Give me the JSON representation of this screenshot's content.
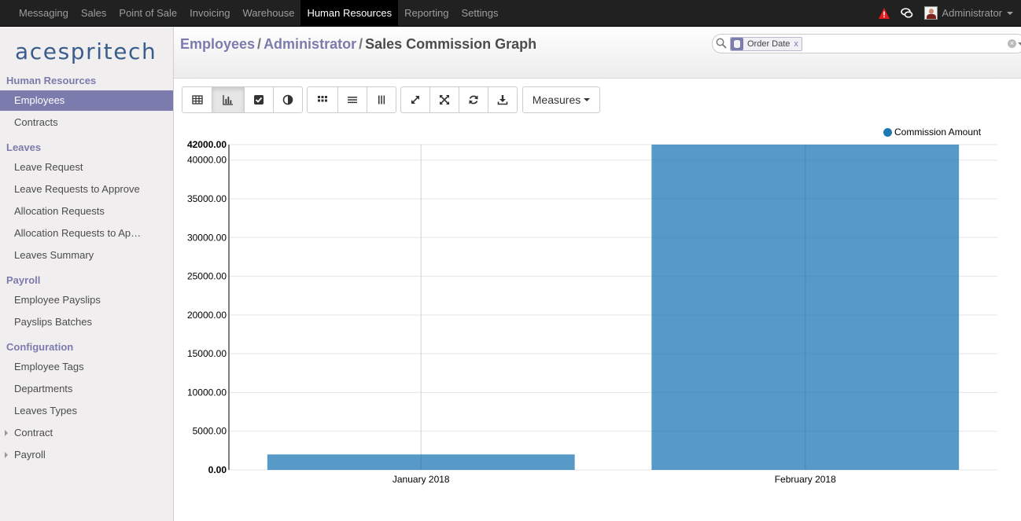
{
  "topbar": {
    "menu": [
      "Messaging",
      "Sales",
      "Point of Sale",
      "Invoicing",
      "Warehouse",
      "Human Resources",
      "Reporting",
      "Settings"
    ],
    "active_index": 5,
    "user_name": "Administrator"
  },
  "sidebar": {
    "logo_text": "acespritech",
    "sections": [
      {
        "title": "Human Resources",
        "items": [
          {
            "label": "Employees",
            "active": true
          },
          {
            "label": "Contracts"
          }
        ]
      },
      {
        "title": "Leaves",
        "items": [
          {
            "label": "Leave Request"
          },
          {
            "label": "Leave Requests to Approve"
          },
          {
            "label": "Allocation Requests"
          },
          {
            "label": "Allocation Requests to Ap…"
          },
          {
            "label": "Leaves Summary"
          }
        ]
      },
      {
        "title": "Payroll",
        "items": [
          {
            "label": "Employee Payslips"
          },
          {
            "label": "Payslips Batches"
          }
        ]
      },
      {
        "title": "Configuration",
        "items": [
          {
            "label": "Employee Tags"
          },
          {
            "label": "Departments"
          },
          {
            "label": "Leaves Types"
          },
          {
            "label": "Contract",
            "expandable": true
          },
          {
            "label": "Payroll",
            "expandable": true
          }
        ]
      }
    ]
  },
  "breadcrumb": {
    "links": [
      "Employees",
      "Administrator"
    ],
    "current": "Sales Commission Graph",
    "separator": "/"
  },
  "search": {
    "facet_label": "Order Date",
    "facet_remove": "x"
  },
  "toolbar": {
    "measures_label": "Measures"
  },
  "colors": {
    "accent": "#7c7bad",
    "navbar": "#212121",
    "bar": "#1f77b4"
  },
  "chart_data": {
    "type": "bar",
    "categories": [
      "January 2018",
      "February 2018"
    ],
    "series": [
      {
        "name": "Commission Amount",
        "values": [
          2000,
          42000
        ]
      }
    ],
    "ylim": [
      0,
      42000
    ],
    "yticks": [
      "0.00",
      "5000.00",
      "10000.00",
      "15000.00",
      "20000.00",
      "25000.00",
      "30000.00",
      "35000.00",
      "40000.00",
      "42000.00"
    ],
    "grid": true,
    "legend": "top-right"
  }
}
